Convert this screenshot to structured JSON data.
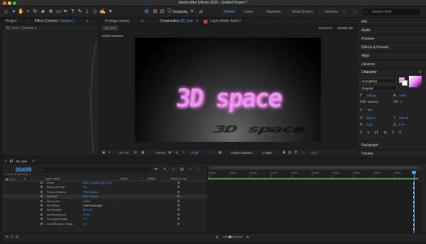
{
  "app": {
    "title": "Adobe After Effects 2020 - Untitled Project *"
  },
  "colors": {
    "accent": "#4a9cff",
    "text_pink": "#e89ae8",
    "layer_red": "#d23b3b",
    "close_red": "#ff5f57",
    "min_yellow": "#ffbd2e",
    "max_green": "#28c840",
    "workarea_green": "#4a9c3a"
  },
  "toolbar": {
    "snapping_label": "Snapping",
    "workspaces": [
      "Default",
      "Learn",
      "Standard",
      "Small Screen",
      "Libraries"
    ],
    "active_workspace": "Default",
    "search_placeholder": "Search Help"
  },
  "left_panel": {
    "tab_project": "Project",
    "tab_effect_controls": "Effect Controls",
    "tab_effect_controls_layer": "Camera 1",
    "breadcrumb": "3D_test • Camera 1"
  },
  "viewer": {
    "tab_footage": "Footage (none)",
    "tab_composition": "Composition",
    "tab_composition_name": "3D_test",
    "tab_layer": "Layer White Solid 2",
    "comp_button": "3D_test",
    "renderer_label": "Renderer:",
    "renderer_value": "Classic 3D",
    "active_camera_label": "Active Camera",
    "scene_text": "3D space",
    "zoom": "66.7%",
    "timecode": "00499",
    "resolution": "(Full)",
    "camera_select": "Active Camera",
    "view_select": "1 View",
    "exposure": "+0.0"
  },
  "right_panel": {
    "items": [
      "Info",
      "Audio",
      "Preview",
      "Effects & Presets",
      "Align",
      "Libraries"
    ],
    "character": {
      "title": "Character",
      "font": "Krungthep",
      "style": "Regular",
      "font_size": "132 px",
      "leading": "Auto",
      "kerning": "Metrics",
      "tracking": "0",
      "stroke": "- px",
      "vscale": "100 %",
      "hscale": "100 %",
      "baseline": "0 px",
      "tsume": "0 %",
      "style_buttons": [
        "T",
        "T",
        "TT",
        "Tt",
        "T",
        "T"
      ]
    },
    "bottom_items": [
      "Paragraph",
      "Tracker"
    ]
  },
  "timeline": {
    "comp_tab": "3D_test",
    "timecode": "00499",
    "timecode_sub": "0:00:16:19 (30.00 fps)",
    "search_placeholder": "",
    "columns": {
      "layer_name": "Layer Name",
      "mode": "Mode",
      "t": "T",
      "trkmat": "TrkMat",
      "parent": "Parent & Link"
    },
    "ruler_ticks": [
      "00000",
      "00050",
      "00100",
      "00150",
      "00200",
      "00250",
      "00300",
      "00350",
      "00400",
      "00450"
    ],
    "properties": [
      {
        "name": "Zoom",
        "value": "1867.0 pixels (54.4° H)"
      },
      {
        "name": "Depth of Field",
        "value": "On"
      },
      {
        "name": "Focus Distance",
        "value": "754.0 pixels"
      },
      {
        "name": "Aperture",
        "value": "409.7 pixels"
      },
      {
        "name": "Blur Level",
        "value": "100%"
      },
      {
        "name": "Iris Shape",
        "value": "Fast Rectangle"
      },
      {
        "name": "Iris Rotation",
        "value": "0x+0.0°"
      },
      {
        "name": "Iris Roundness",
        "value": "0.0%"
      },
      {
        "name": "Iris Aspect Ratio",
        "value": "1.0"
      },
      {
        "name": "Iris Diffraction Fringe",
        "value": "0.0"
      }
    ]
  }
}
